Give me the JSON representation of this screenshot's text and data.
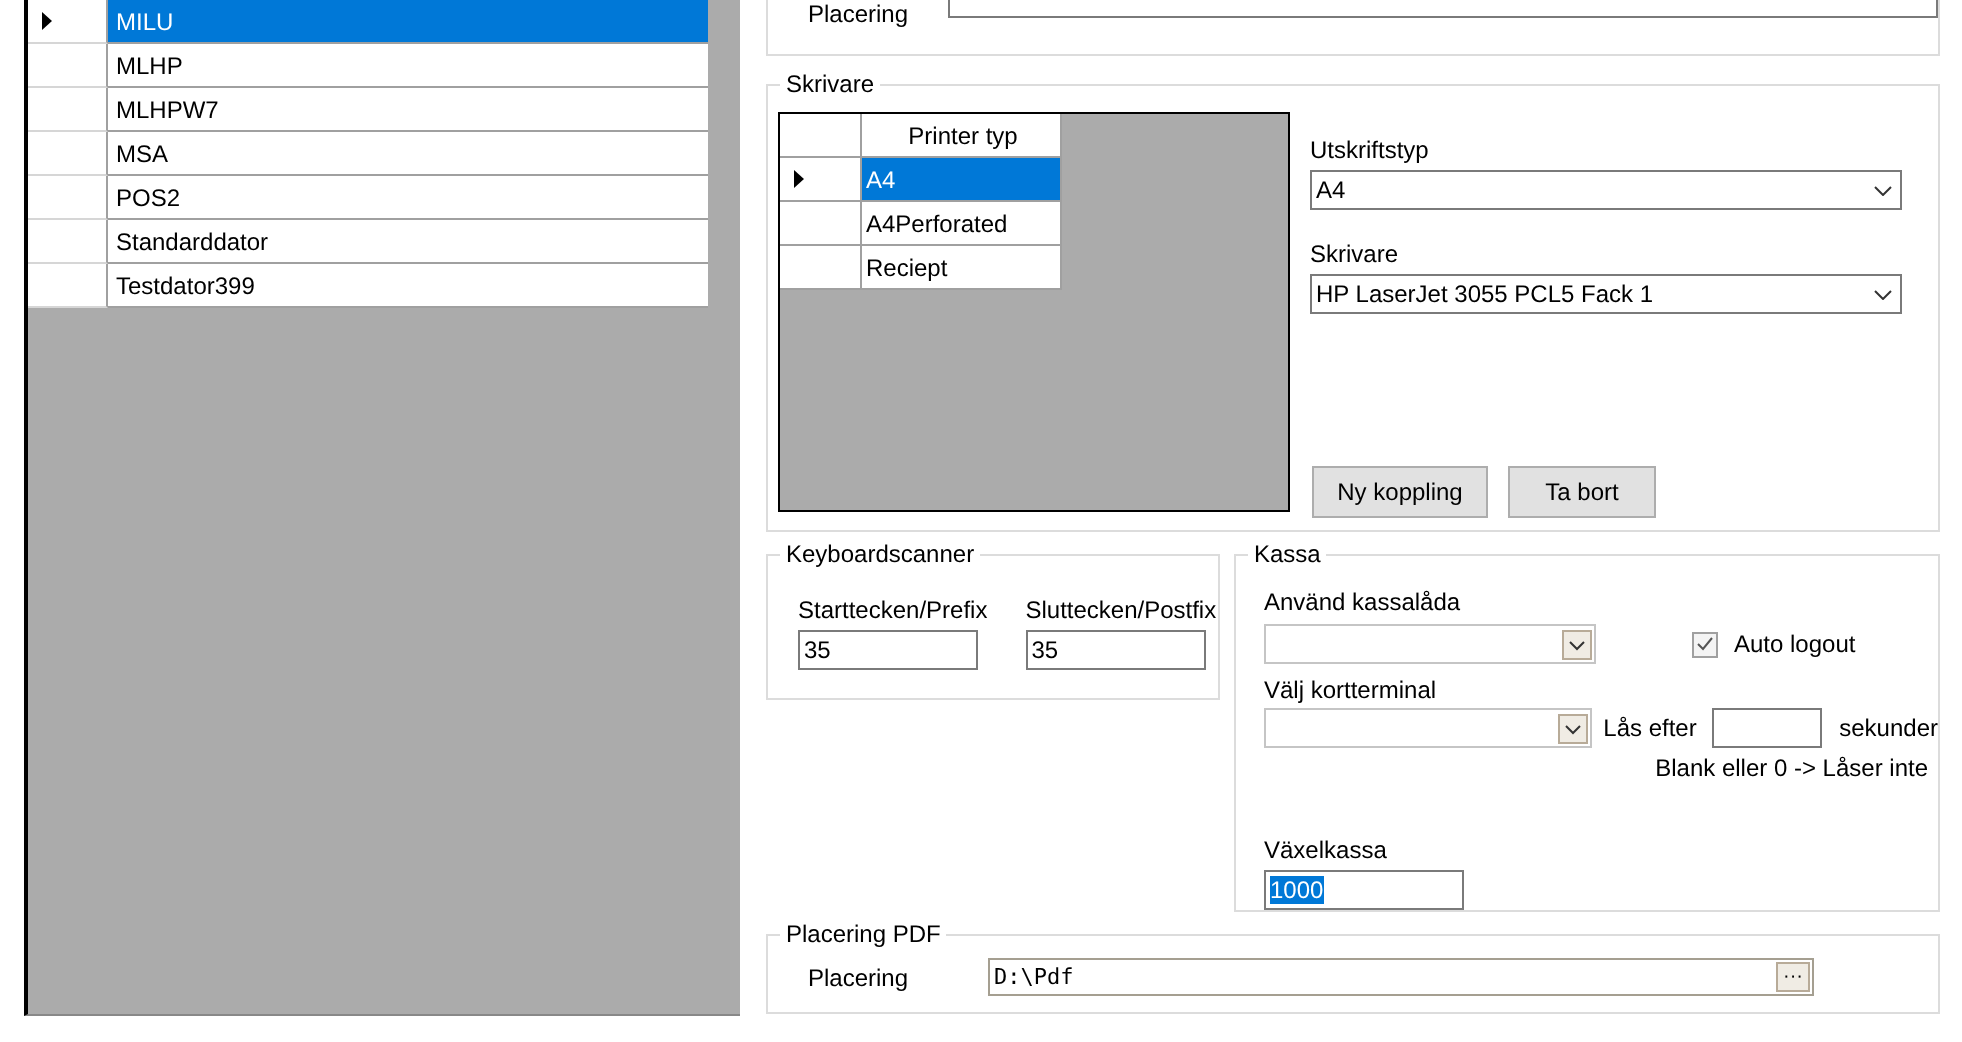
{
  "computers": {
    "rows": [
      {
        "name": "MILU",
        "selected": true
      },
      {
        "name": "MLHP",
        "selected": false
      },
      {
        "name": "MLHPW7",
        "selected": false
      },
      {
        "name": "MSA",
        "selected": false
      },
      {
        "name": "POS2",
        "selected": false
      },
      {
        "name": "Standarddator",
        "selected": false
      },
      {
        "name": "Testdator399",
        "selected": false
      }
    ]
  },
  "top_group": {
    "field_label": "Placering"
  },
  "printers": {
    "title": "Skrivare",
    "table": {
      "column": "Printer typ",
      "rows": [
        {
          "name": "A4",
          "selected": true
        },
        {
          "name": "A4Perforated",
          "selected": false
        },
        {
          "name": "Reciept",
          "selected": false
        }
      ]
    },
    "print_type": {
      "label": "Utskriftstyp",
      "value": "A4"
    },
    "printer": {
      "label": "Skrivare",
      "value": "HP LaserJet 3055 PCL5 Fack 1"
    },
    "buttons": [
      "Ny koppling",
      "Ta bort"
    ]
  },
  "keyboard_scanner": {
    "title": "Keyboardscanner",
    "fields": [
      {
        "label": "Starttecken/Prefix",
        "value": "35"
      },
      {
        "label": "Sluttecken/Postfix",
        "value": "35"
      }
    ]
  },
  "kassa": {
    "title": "Kassa",
    "cash_drawer": {
      "label": "Använd kassalåda"
    },
    "auto_logout": {
      "label": "Auto logout",
      "checked": true
    },
    "card_terminal": {
      "label": "Välj kortterminal"
    },
    "lock_after": {
      "label": "Lås efter",
      "unit": "sekunder",
      "hint": "Blank eller 0 -> Låser inte"
    },
    "change_fund": {
      "label": "Växelkassa",
      "value": "1000",
      "selected": true
    }
  },
  "pdf": {
    "title": "Placering PDF",
    "label": "Placering",
    "value": "D:\\Pdf",
    "browse": "···"
  }
}
